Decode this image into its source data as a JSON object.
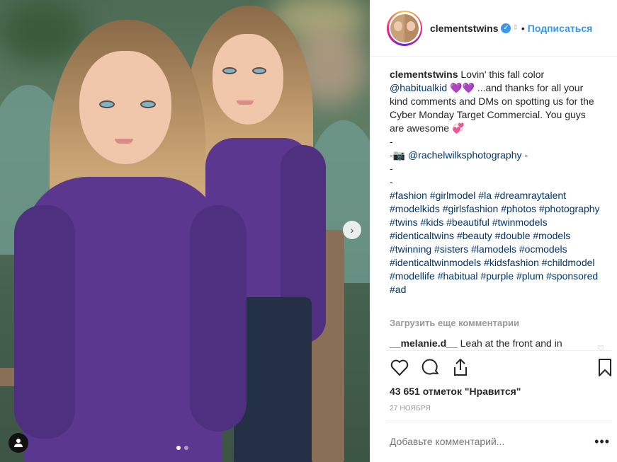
{
  "header": {
    "username": "clementstwins",
    "separator": "•",
    "follow_label": "Подписаться"
  },
  "caption": {
    "username": "clementstwins",
    "line1_text": "Lovin' this fall color",
    "mention": "@habitualkid",
    "hearts_purple": "💜💜",
    "body": "...and thanks for all your kind comments and DMs on spotting us for the Cyber Monday Target Commercial. You guys are awesome",
    "hearts_red": "💞",
    "dash1": "-",
    "photo_credit_prefix": "-📷",
    "photo_credit": "@rachelwilksphotography",
    "photo_credit_suffix": " -",
    "dash2": "-",
    "dash3": "-",
    "hashtags": "#fashion #girlmodel #la #dreamraytalent #modelkids #girlsfashion #photos #photography #twins #kids #beautiful #twinmodels #identicaltwins #beauty #double #models #twinning #sisters #lamodels #ocmodels #identicaltwinmodels #kidsfashion #childmodel #modellife #habitual #purple #plum #sponsored #ad"
  },
  "comments": {
    "load_more": "Загрузить еще комментарии",
    "first": {
      "username": "__melanie.d__",
      "text": "Leah at the front and in"
    }
  },
  "stats": {
    "likes": "43 651 отметок \"Нравится\"",
    "date": "27 НОЯБРЯ"
  },
  "composer": {
    "placeholder": "Добавьте комментарий...",
    "more": "•••"
  },
  "carousel": {
    "slide_count": 2,
    "active_slide": 1
  },
  "colors": {
    "link_blue": "#3897f0",
    "mention_blue": "#003569",
    "muted_gray": "#999999"
  },
  "icons": [
    "verified-icon",
    "chevron-right-icon",
    "user-tag-icon",
    "heart-icon",
    "comment-icon",
    "share-icon",
    "bookmark-icon",
    "more-options-icon"
  ]
}
